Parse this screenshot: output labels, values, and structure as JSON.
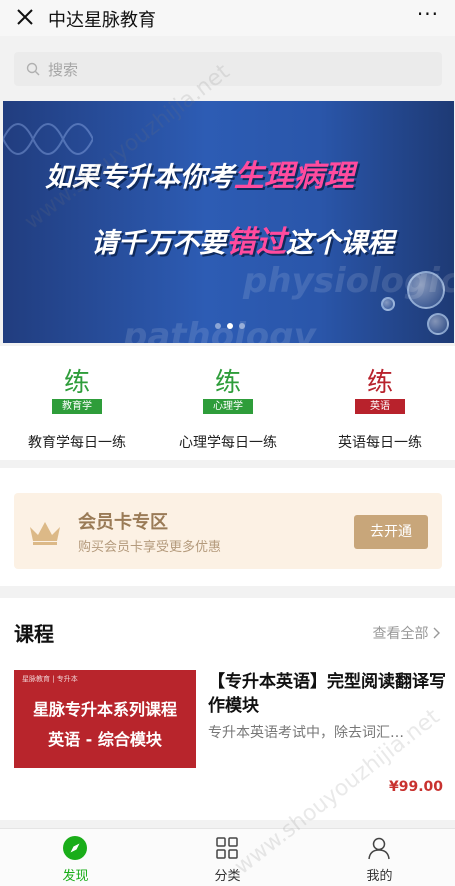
{
  "topbar": {
    "title": "中达星脉教育",
    "close_icon": "close-icon",
    "more_icon": "more-icon",
    "more_text": "···"
  },
  "search": {
    "placeholder": "搜索",
    "icon": "search-icon"
  },
  "banner": {
    "line1_prefix": "如果专升本你考",
    "line1_highlight": "生理病理",
    "line2_prefix": "请千万不要",
    "line2_highlight": "错过",
    "line2_suffix": "这个课程",
    "bg_text_1": "physiological",
    "bg_text_2": "pathology",
    "slides": 3,
    "active_slide": 2,
    "highlight_color": "#ff4b9e"
  },
  "practice": [
    {
      "char": "练",
      "tag": "教育学",
      "label": "教育学每日一练",
      "color": "#2e9d3a"
    },
    {
      "char": "练",
      "tag": "心理学",
      "label": "心理学每日一练",
      "color": "#2e9d3a"
    },
    {
      "char": "练",
      "tag": "英语",
      "label": "英语每日一练",
      "color": "#b8222c"
    }
  ],
  "vip": {
    "icon": "crown-icon",
    "title": "会员卡专区",
    "subtitle": "购买会员卡享受更多优惠",
    "button": "去开通"
  },
  "courses": {
    "heading": "课程",
    "view_all": "查看全部",
    "items": [
      {
        "thumb_logo": "星脉教育 | 专升本",
        "thumb_line1": "星脉专升本系列课程",
        "thumb_line2": "英语 - 综合模块",
        "title": "【专升本英语】完型阅读翻译写作模块",
        "desc": "专升本英语考试中，除去词汇…",
        "price": "¥99.00"
      }
    ]
  },
  "tabbar": [
    {
      "label": "发现",
      "icon": "compass-icon",
      "active": true
    },
    {
      "label": "分类",
      "icon": "grid-icon",
      "active": false
    },
    {
      "label": "我的",
      "icon": "person-icon",
      "active": false
    }
  ],
  "watermark": "www.shouyouzhijia.net",
  "colors": {
    "accent": "#1aad19",
    "price": "#c8322f",
    "vip_button": "#c8a67a",
    "vip_bg": "#fcf1e4"
  }
}
